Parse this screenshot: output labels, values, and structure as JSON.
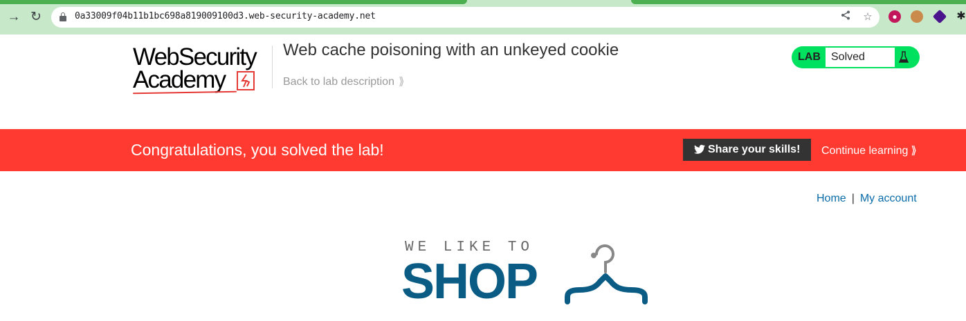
{
  "browser": {
    "url": "0a33009f04b11b1bc698a819009100d3.web-security-academy.net",
    "icons": [
      "back-icon",
      "reload-icon",
      "lock-icon",
      "share-icon",
      "bookmark-star-icon",
      "extension-icon",
      "cookie-icon",
      "extension-icon",
      "puzzle-icon"
    ]
  },
  "header": {
    "logo_line1": "WebSecurity",
    "logo_line2": "Academy",
    "lab_title": "Web cache poisoning with an unkeyed cookie",
    "back_link": "Back to lab description",
    "status_label": "LAB",
    "status_value": "Solved"
  },
  "banner": {
    "message": "Congratulations, you solved the lab!",
    "share_label": "Share your skills!",
    "continue_label": "Continue learning"
  },
  "shop_nav": {
    "home": "Home",
    "separator": "|",
    "account": "My account"
  },
  "shop_logo": {
    "tagline": "WE LIKE TO",
    "word": "SHOP"
  },
  "colors": {
    "banner": "#ff3a30",
    "status": "#00e160",
    "link": "#0a6ba8",
    "shop": "#0b5c85"
  }
}
